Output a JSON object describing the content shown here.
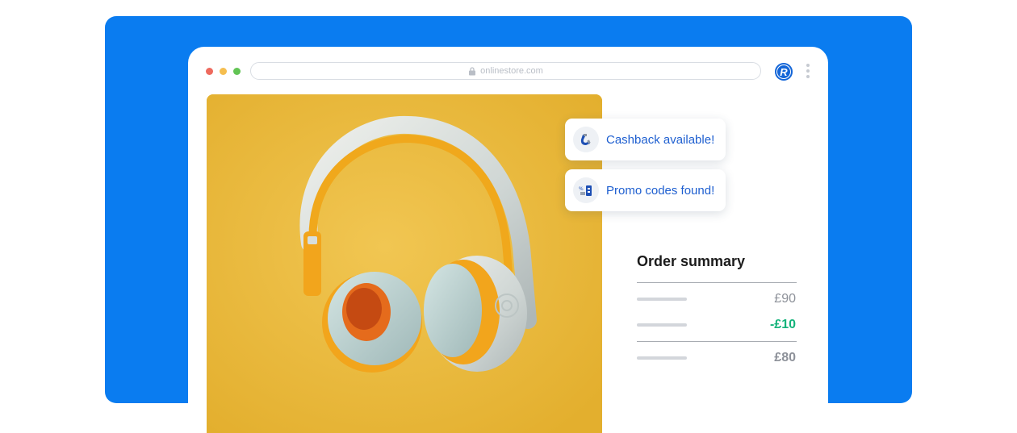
{
  "browser": {
    "url": "onlinestore.com",
    "profile_initial": "R",
    "window_dots": [
      "#ee6a5e",
      "#f5be4f",
      "#62c454"
    ]
  },
  "notifications": {
    "cashback_label": "Cashback available!",
    "promo_label": "Promo codes found!"
  },
  "order_summary": {
    "title": "Order summary",
    "subtotal": "£90",
    "discount": "-£10",
    "total": "£80"
  },
  "colors": {
    "panel_blue": "#0a7cf0",
    "accent_blue": "#1e5fd0",
    "discount_green": "#13b37a",
    "product_bg": "#eab93c"
  },
  "icons": {
    "cashback": "magnet-icon",
    "promo": "coupon-icon",
    "lock": "lock-icon",
    "menu": "kebab-menu-icon"
  }
}
